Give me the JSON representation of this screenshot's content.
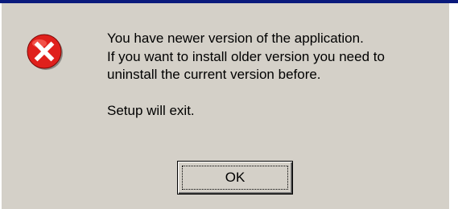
{
  "dialog": {
    "icon": "error-icon",
    "message_lines": [
      "You have newer version of the application.",
      "If you want to install older version you need to",
      "uninstall the current version before."
    ],
    "exit_line": "Setup will exit.",
    "ok_label": "OK"
  },
  "colors": {
    "dialog_background": "#d4d0c8",
    "title_bar": "#0a1a7c",
    "icon_red": "#e0201c",
    "icon_x": "#ffffff"
  }
}
